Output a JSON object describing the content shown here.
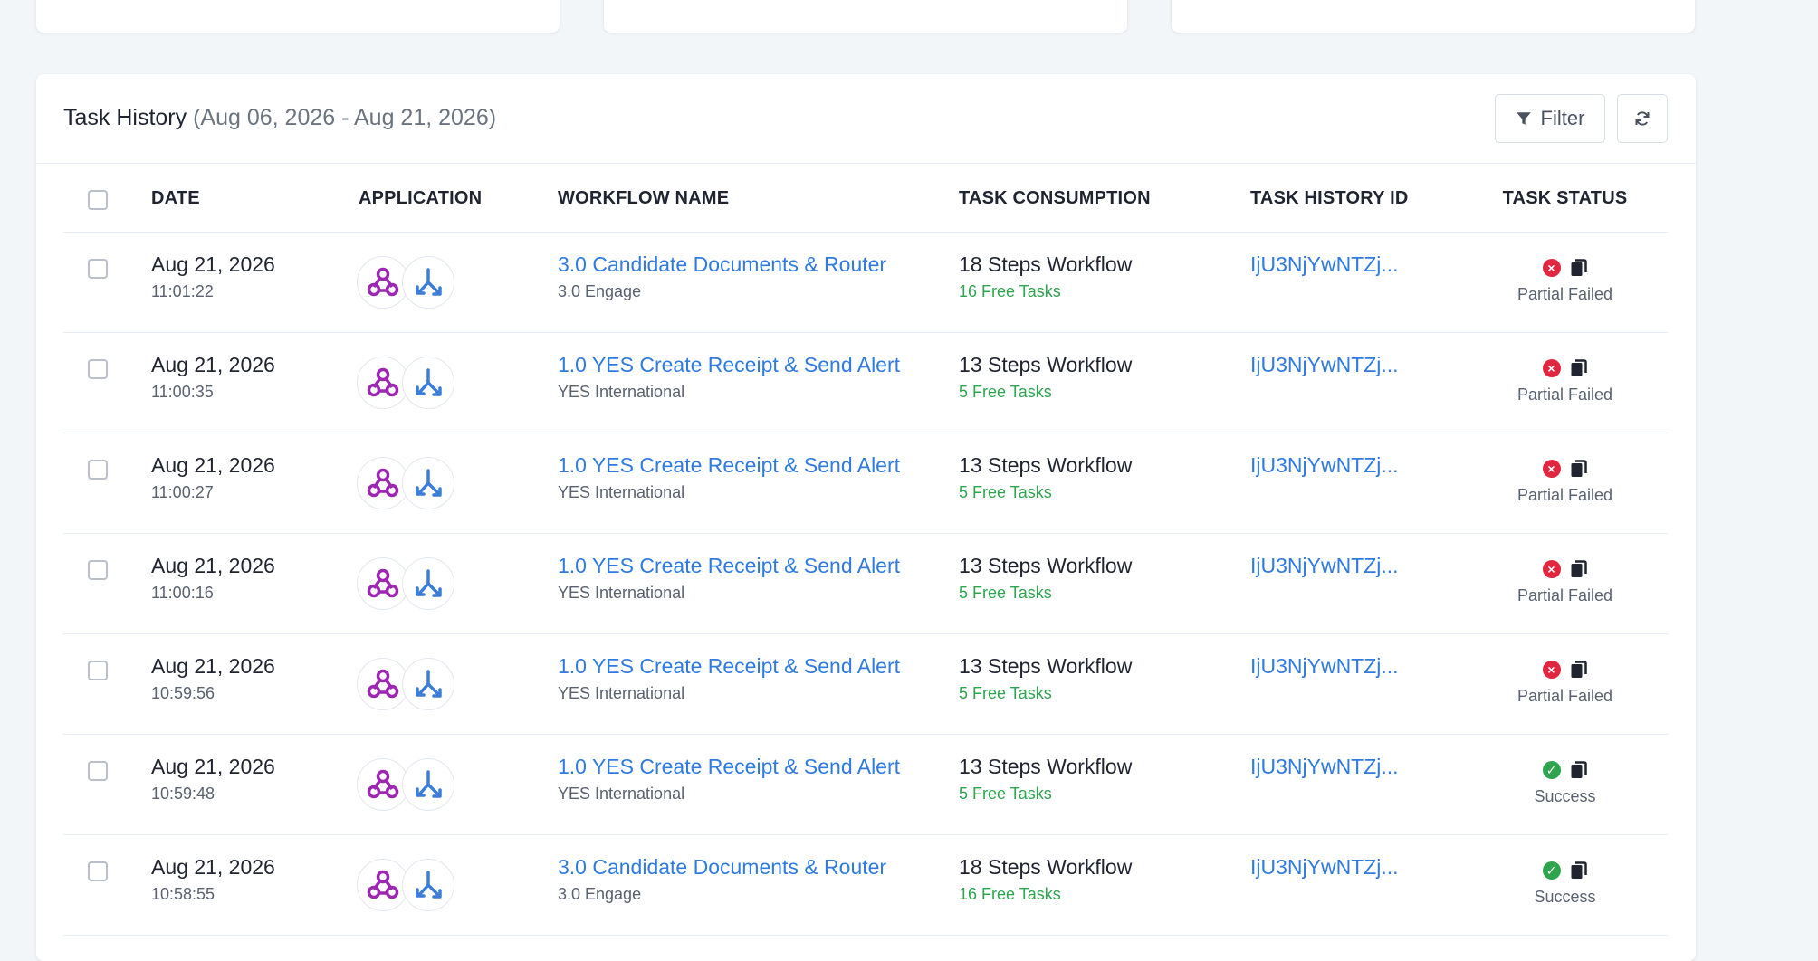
{
  "colors": {
    "link": "#2f7be0",
    "free_tasks": "#2ea44f",
    "failed": "#e0273f",
    "success": "#2ea44f",
    "app_primary": "#9c27b0",
    "app_router": "#3b7dd8"
  },
  "panel": {
    "title": "Task History",
    "range": "(Aug 06, 2026 - Aug 21, 2026)",
    "filter_label": "Filter"
  },
  "columns": {
    "date": "DATE",
    "application": "APPLICATION",
    "workflow": "WORKFLOW NAME",
    "consumption": "TASK CONSUMPTION",
    "history_id": "TASK HISTORY ID",
    "status": "TASK STATUS"
  },
  "rows": [
    {
      "date": "Aug 21, 2026",
      "time": "11:01:22",
      "apps": [
        "webhook-icon",
        "router-icon"
      ],
      "workflow": "3.0 Candidate Documents & Router",
      "workspace": "3.0 Engage",
      "steps": "18 Steps Workflow",
      "free": "16 Free Tasks",
      "history_id": "IjU3NjYwNTZj...",
      "status": "Partial Failed",
      "status_kind": "failed"
    },
    {
      "date": "Aug 21, 2026",
      "time": "11:00:35",
      "apps": [
        "webhook-icon",
        "router-icon"
      ],
      "workflow": "1.0 YES Create Receipt & Send Alert",
      "workspace": "YES International",
      "steps": "13 Steps Workflow",
      "free": "5 Free Tasks",
      "history_id": "IjU3NjYwNTZj...",
      "status": "Partial Failed",
      "status_kind": "failed"
    },
    {
      "date": "Aug 21, 2026",
      "time": "11:00:27",
      "apps": [
        "webhook-icon",
        "router-icon"
      ],
      "workflow": "1.0 YES Create Receipt & Send Alert",
      "workspace": "YES International",
      "steps": "13 Steps Workflow",
      "free": "5 Free Tasks",
      "history_id": "IjU3NjYwNTZj...",
      "status": "Partial Failed",
      "status_kind": "failed"
    },
    {
      "date": "Aug 21, 2026",
      "time": "11:00:16",
      "apps": [
        "webhook-icon",
        "router-icon"
      ],
      "workflow": "1.0 YES Create Receipt & Send Alert",
      "workspace": "YES International",
      "steps": "13 Steps Workflow",
      "free": "5 Free Tasks",
      "history_id": "IjU3NjYwNTZj...",
      "status": "Partial Failed",
      "status_kind": "failed"
    },
    {
      "date": "Aug 21, 2026",
      "time": "10:59:56",
      "apps": [
        "webhook-icon",
        "router-icon"
      ],
      "workflow": "1.0 YES Create Receipt & Send Alert",
      "workspace": "YES International",
      "steps": "13 Steps Workflow",
      "free": "5 Free Tasks",
      "history_id": "IjU3NjYwNTZj...",
      "status": "Partial Failed",
      "status_kind": "failed"
    },
    {
      "date": "Aug 21, 2026",
      "time": "10:59:48",
      "apps": [
        "webhook-icon",
        "router-icon"
      ],
      "workflow": "1.0 YES Create Receipt & Send Alert",
      "workspace": "YES International",
      "steps": "13 Steps Workflow",
      "free": "5 Free Tasks",
      "history_id": "IjU3NjYwNTZj...",
      "status": "Success",
      "status_kind": "success"
    },
    {
      "date": "Aug 21, 2026",
      "time": "10:58:55",
      "apps": [
        "webhook-icon",
        "router-icon"
      ],
      "workflow": "3.0 Candidate Documents & Router",
      "workspace": "3.0 Engage",
      "steps": "18 Steps Workflow",
      "free": "16 Free Tasks",
      "history_id": "IjU3NjYwNTZj...",
      "status": "Success",
      "status_kind": "success"
    }
  ]
}
